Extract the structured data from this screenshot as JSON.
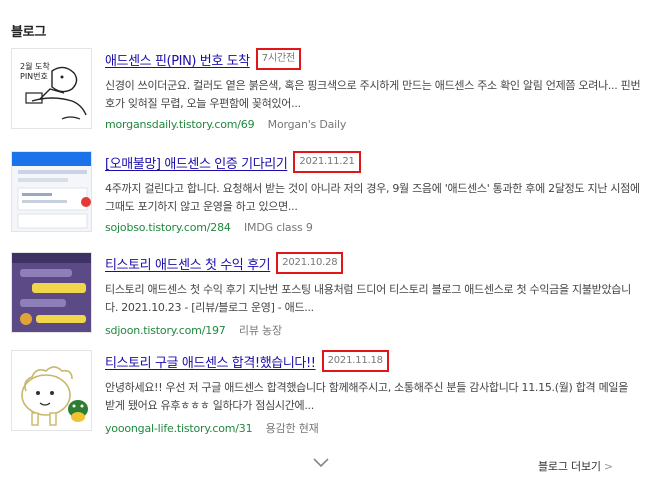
{
  "section": {
    "title": "블로그"
  },
  "posts": [
    {
      "title": "애드센스 핀(PIN) 번호 도착",
      "date": "7시간전",
      "snippet": "신경이 쓰이더군요. 컬러도 옅은 붉은색, 혹은 핑크색으로 주시하게 만드는 애드센스 주소 확인 알림 언제쯤 오려나... 핀번호가 잊혀질 무렵, 오늘 우편함에 꽂혀있어...",
      "url": "morgansdaily.tistory.com/69",
      "author": "Morgan's Daily",
      "thumb_icon": "sketch-illustration-icon"
    },
    {
      "title": "[오매불망] 애드센스 인증 기다리기",
      "date": "2021.11.21",
      "snippet": "4주까지 걸린다고 합니다. 요청해서 받는 것이 아니라 저의 경우, 9월 즈음에 '애드센스' 통과한 후에 2달정도 지난 시점에 그때도 포기하지 않고 운영을 하고 있으면...",
      "url": "sojobso.tistory.com/284",
      "author": "IMDG class 9",
      "thumb_icon": "dashboard-screenshot-icon"
    },
    {
      "title": "티스토리 애드센스 첫 수익 후기",
      "date": "2021.10.28",
      "snippet": "티스토리 애드센스 첫 수익 후기 지난번 포스팅 내용처럼 드디어 티스토리 블로그 애드센스로 첫 수익금을 지불받았습니다. 2021.10.23 - [리뷰/블로그 운영] - 애드...",
      "url": "sdjoon.tistory.com/197",
      "author": "리뷰 농장",
      "thumb_icon": "app-screenshot-icon"
    },
    {
      "title": "티스토리 구글 애드센스 합격!했습니다!!",
      "date": "2021.11.18",
      "snippet": "안녕하세요!! 우선 저 구글 애드센스 합격했습니다 함께해주시고, 소통해주신 분들 감사합니다 11.15.(월) 합격 메일을 받게 됐어요 유후ㅎㅎㅎ 일하다가 점심시간에...",
      "url": "yooongal-life.tistory.com/31",
      "author": "용감한 현재",
      "thumb_icon": "cartoon-sheep-icon"
    }
  ],
  "footer": {
    "more_label": "블로그 더보기",
    "more_arrow": ">"
  }
}
